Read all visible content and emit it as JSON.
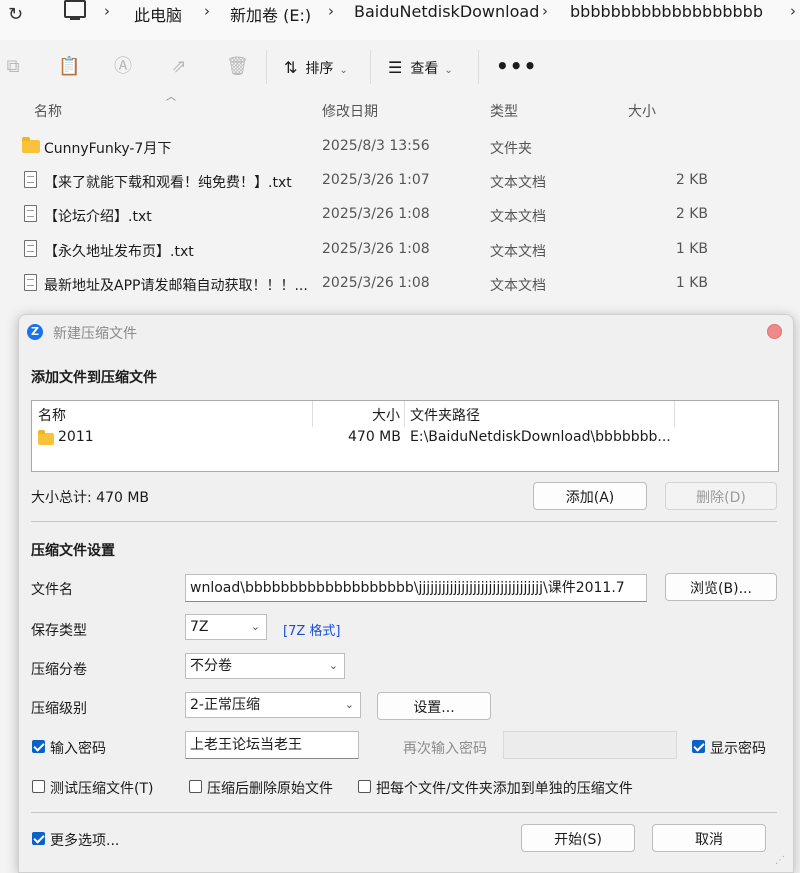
{
  "explorer": {
    "breadcrumbs": [
      "此电脑",
      "新加卷 (E:)",
      "BaiduNetdiskDownload",
      "bbbbbbbbbbbbbbbbbbb"
    ],
    "toolbar": {
      "sort_label": "排序",
      "view_label": "查看",
      "more_label": "•••"
    },
    "columns": {
      "name": "名称",
      "date": "修改日期",
      "type": "类型",
      "size": "大小"
    },
    "files": [
      {
        "icon": "folder-icon",
        "name": "CunnyFunky-7月下",
        "date": "2025/8/3 13:56",
        "type": "文件夹",
        "size": ""
      },
      {
        "icon": "text-file-icon",
        "name": "【来了就能下载和观看！纯免费！】.txt",
        "date": "2025/3/26 1:07",
        "type": "文本文档",
        "size": "2 KB"
      },
      {
        "icon": "text-file-icon",
        "name": "【论坛介绍】.txt",
        "date": "2025/3/26 1:08",
        "type": "文本文档",
        "size": "2 KB"
      },
      {
        "icon": "text-file-icon",
        "name": "【永久地址发布页】.txt",
        "date": "2025/3/26 1:08",
        "type": "文本文档",
        "size": "1 KB"
      },
      {
        "icon": "text-file-icon",
        "name": "最新地址及APP请发邮箱自动获取！！！...",
        "date": "2025/3/26 1:08",
        "type": "文本文档",
        "size": "1 KB"
      }
    ]
  },
  "dialog": {
    "title": "新建压缩文件",
    "add_section_title": "添加文件到压缩文件",
    "table_headers": {
      "name": "名称",
      "size": "大小",
      "path": "文件夹路径"
    },
    "items": [
      {
        "name": "2011",
        "size": "470 MB",
        "path": "E:\\BaiduNetdiskDownload\\bbbbbbb..."
      }
    ],
    "total_size": "大小总计: 470 MB",
    "add_button": "添加(A)",
    "delete_button": "删除(D)",
    "settings_section_title": "压缩文件设置",
    "filename_label": "文件名",
    "filename_value": "wnload\\bbbbbbbbbbbbbbbbbbb\\jjjjjjjjjjjjjjjjjjjjjjjjjjjjjjjj\\课件2011.7",
    "browse_button": "浏览(B)...",
    "save_type_label": "保存类型",
    "save_type_value": "7Z",
    "format_link": "[7Z 格式]",
    "split_label": "压缩分卷",
    "split_value": "不分卷",
    "level_label": "压缩级别",
    "level_value": "2-正常压缩",
    "settings_button": "设置...",
    "password_label": "输入密码",
    "password_value": "上老王论坛当老王",
    "confirm_password_label": "再次输入密码",
    "show_password_label": "显示密码",
    "test_archive_label": "测试压缩文件(T)",
    "delete_after_label": "压缩后删除原始文件",
    "separate_archive_label": "把每个文件/文件夹添加到单独的压缩文件",
    "more_options_label": "更多选项...",
    "start_button": "开始(S)",
    "cancel_button": "取消"
  }
}
